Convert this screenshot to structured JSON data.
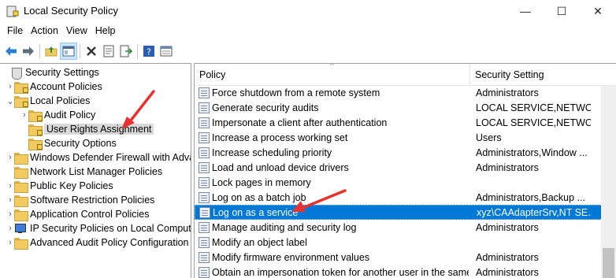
{
  "window": {
    "title": "Local Security Policy",
    "controls": {
      "minimize": "—",
      "maximize": "☐",
      "close": "✕"
    }
  },
  "menu": [
    "File",
    "Action",
    "View",
    "Help"
  ],
  "toolbar": {
    "icons": [
      "back-arrow-icon",
      "forward-arrow-icon",
      "up-folder-icon",
      "show-hide-tree-icon",
      "delete-icon",
      "properties-icon",
      "export-list-icon",
      "help-icon",
      "view-icon"
    ]
  },
  "tree": {
    "items": [
      {
        "label": "Security Settings",
        "icon": "shield",
        "level": 0,
        "expander": ""
      },
      {
        "label": "Account Policies",
        "icon": "folder-lock",
        "level": 1,
        "expander": "›"
      },
      {
        "label": "Local Policies",
        "icon": "folder-lock",
        "level": 1,
        "expander": "⌄"
      },
      {
        "label": "Audit Policy",
        "icon": "folder-lock",
        "level": 2,
        "expander": "›"
      },
      {
        "label": "User Rights Assignment",
        "icon": "folder-lock",
        "level": 2,
        "expander": "",
        "selected": true
      },
      {
        "label": "Security Options",
        "icon": "folder-lock",
        "level": 2,
        "expander": ""
      },
      {
        "label": "Windows Defender Firewall with Adva",
        "icon": "folder",
        "level": 1,
        "expander": "›"
      },
      {
        "label": "Network List Manager Policies",
        "icon": "folder",
        "level": 1,
        "expander": ""
      },
      {
        "label": "Public Key Policies",
        "icon": "folder",
        "level": 1,
        "expander": "›"
      },
      {
        "label": "Software Restriction Policies",
        "icon": "folder",
        "level": 1,
        "expander": "›"
      },
      {
        "label": "Application Control Policies",
        "icon": "folder",
        "level": 1,
        "expander": "›"
      },
      {
        "label": "IP Security Policies on Local Compute",
        "icon": "monitor",
        "level": 1,
        "expander": "›"
      },
      {
        "label": "Advanced Audit Policy Configuration",
        "icon": "folder",
        "level": 1,
        "expander": "›"
      }
    ]
  },
  "list": {
    "columns": {
      "policy": "Policy",
      "setting": "Security Setting"
    },
    "rows": [
      {
        "policy": "Force shutdown from a remote system",
        "setting": "Administrators"
      },
      {
        "policy": "Generate security audits",
        "setting": "LOCAL SERVICE,NETWO..."
      },
      {
        "policy": "Impersonate a client after authentication",
        "setting": "LOCAL SERVICE,NETWO..."
      },
      {
        "policy": "Increase a process working set",
        "setting": "Users"
      },
      {
        "policy": "Increase scheduling priority",
        "setting": "Administrators,Window ..."
      },
      {
        "policy": "Load and unload device drivers",
        "setting": "Administrators"
      },
      {
        "policy": "Lock pages in memory",
        "setting": ""
      },
      {
        "policy": "Log on as a batch job",
        "setting": "Administrators,Backup ..."
      },
      {
        "policy": "Log on as a service",
        "setting": "xyz\\CAAdapterSrv,NT SE...",
        "selected": true
      },
      {
        "policy": "Manage auditing and security log",
        "setting": "Administrators"
      },
      {
        "policy": "Modify an object label",
        "setting": ""
      },
      {
        "policy": "Modify firmware environment values",
        "setting": "Administrators"
      },
      {
        "policy": "Obtain an impersonation token for another user in the same...",
        "setting": "Administrators"
      }
    ]
  },
  "colors": {
    "selection": "#0078d7",
    "tree_selection": "#d9d9d9",
    "annotation_arrow": "#e8322f"
  }
}
